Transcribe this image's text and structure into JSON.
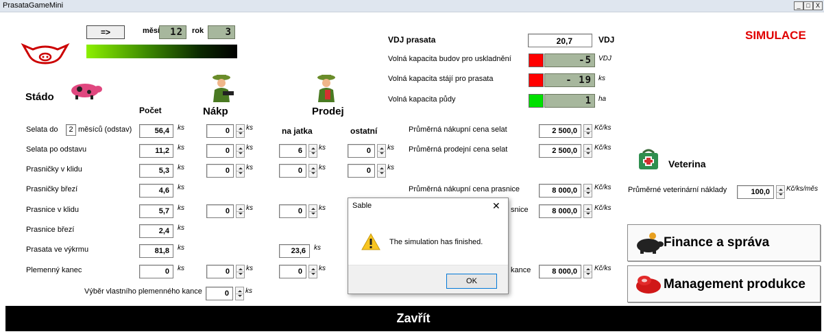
{
  "window": {
    "title": "PrasataGameMini",
    "min": "_",
    "max": "□",
    "close": "X"
  },
  "top": {
    "next_button": "=>",
    "month_label": "měsíc",
    "month_value": "12",
    "year_label": "rok",
    "year_value": "3"
  },
  "simulace": "SIMULACE",
  "vdj": {
    "label": "VDJ prasata",
    "value": "20,7",
    "unit": "VDJ",
    "rows": [
      {
        "label": "Volná kapacita budov pro uskladnění",
        "value": "-5",
        "unit": "VDJ",
        "status_color": "#ff0000"
      },
      {
        "label": "Volná kapacita stájí pro prasata",
        "value": "- 19",
        "unit": "ks",
        "status_color": "#ff0000"
      },
      {
        "label": "Volná kapacita půdy",
        "value": "1",
        "unit": "ha",
        "status_color": "#00e000"
      }
    ]
  },
  "herd": {
    "title": "Stádo",
    "pocet": "Počet",
    "nakp": "Nákp",
    "prodej": "Prodej",
    "na_jatka": "na jatka",
    "ostatni": "ostatní",
    "unit": "ks",
    "rows": [
      {
        "label": "Selata do",
        "box": "2",
        "label2": "měsíců (odstav)",
        "count": "56,4",
        "buy": "0",
        "slaughter": "",
        "other": ""
      },
      {
        "label": "Selata po odstavu",
        "count": "11,2",
        "buy": "0",
        "slaughter": "6",
        "other": "0"
      },
      {
        "label": "Prasničky v klidu",
        "count": "5,3",
        "buy": "0",
        "slaughter": "0",
        "other": "0"
      },
      {
        "label": "Prasničky březí",
        "count": "4,6"
      },
      {
        "label": "Prasnice v klidu",
        "count": "5,7",
        "buy": "0",
        "slaughter": "0"
      },
      {
        "label": "Prasnice březí",
        "count": "2,4"
      },
      {
        "label": "Prasata ve výkrmu",
        "count": "81,8",
        "slaughter": "23,6"
      },
      {
        "label": "Plemenný kanec",
        "count": "0",
        "buy": "0",
        "slaughter": "0"
      }
    ],
    "own_boar_label": "Výběr vlastního plemenného kance",
    "own_boar_value": "0"
  },
  "prices": {
    "unit": "Kč/ks",
    "rows": [
      {
        "label": "Průměrná nákupní cena selat",
        "value": "2 500,0"
      },
      {
        "label": "Průměrná prodejní cena selat",
        "value": "2 500,0"
      },
      {
        "label": "Průměrná nákupní cena prasnice",
        "value": "8 000,0"
      },
      {
        "label": "snice",
        "value": "8 000,0"
      },
      {
        "label": "kance",
        "value": "8 000,0"
      }
    ]
  },
  "veterina": {
    "title": "Veterina",
    "label": "Průměrné veterinární náklady",
    "value": "100,0",
    "unit": "Kč/ks/měs"
  },
  "buttons": {
    "finance": "Finance a správa",
    "management": "Management produkce",
    "close": "Zavřít"
  },
  "dialog": {
    "title": "Sable",
    "close": "✕",
    "message": "The simulation has finished.",
    "ok": "OK"
  },
  "colors": {
    "title_red": "#e00000",
    "led_red": "#ff0000",
    "led_green": "#00e000"
  }
}
